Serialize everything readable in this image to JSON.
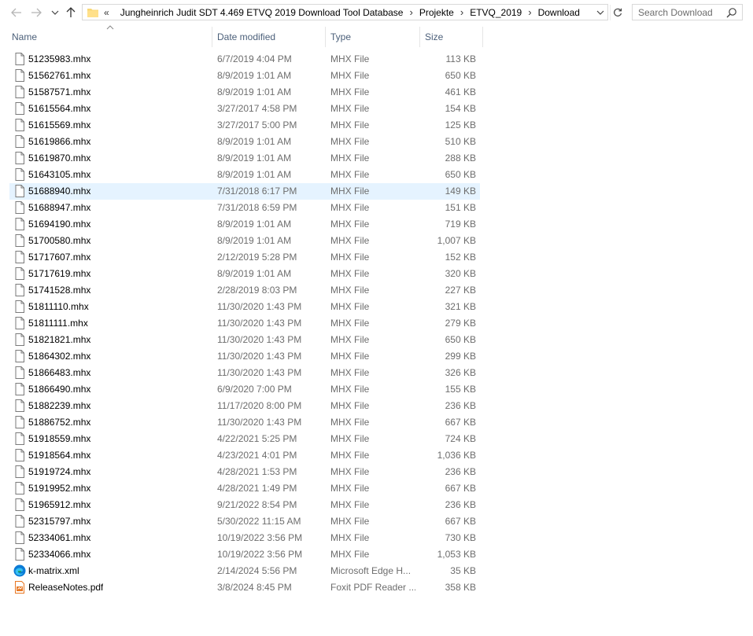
{
  "address": {
    "overflow": "«",
    "crumbs": [
      "Jungheinrich Judit SDT 4.469 ETVQ 2019 Download Tool Database",
      "Projekte",
      "ETVQ_2019",
      "Download"
    ]
  },
  "search": {
    "placeholder": "Search Download"
  },
  "columns": {
    "name": "Name",
    "date": "Date modified",
    "type": "Type",
    "size": "Size"
  },
  "files": [
    {
      "name": "51235983.mhx",
      "date": "6/7/2019 4:04 PM",
      "type": "MHX File",
      "size": "113 KB",
      "icon": "file-icon"
    },
    {
      "name": "51562761.mhx",
      "date": "8/9/2019 1:01 AM",
      "type": "MHX File",
      "size": "650 KB",
      "icon": "file-icon"
    },
    {
      "name": "51587571.mhx",
      "date": "8/9/2019 1:01 AM",
      "type": "MHX File",
      "size": "461 KB",
      "icon": "file-icon"
    },
    {
      "name": "51615564.mhx",
      "date": "3/27/2017 4:58 PM",
      "type": "MHX File",
      "size": "154 KB",
      "icon": "file-icon"
    },
    {
      "name": "51615569.mhx",
      "date": "3/27/2017 5:00 PM",
      "type": "MHX File",
      "size": "125 KB",
      "icon": "file-icon"
    },
    {
      "name": "51619866.mhx",
      "date": "8/9/2019 1:01 AM",
      "type": "MHX File",
      "size": "510 KB",
      "icon": "file-icon"
    },
    {
      "name": "51619870.mhx",
      "date": "8/9/2019 1:01 AM",
      "type": "MHX File",
      "size": "288 KB",
      "icon": "file-icon"
    },
    {
      "name": "51643105.mhx",
      "date": "8/9/2019 1:01 AM",
      "type": "MHX File",
      "size": "650 KB",
      "icon": "file-icon"
    },
    {
      "name": "51688940.mhx",
      "date": "7/31/2018 6:17 PM",
      "type": "MHX File",
      "size": "149 KB",
      "icon": "file-icon",
      "selected": true
    },
    {
      "name": "51688947.mhx",
      "date": "7/31/2018 6:59 PM",
      "type": "MHX File",
      "size": "151 KB",
      "icon": "file-icon"
    },
    {
      "name": "51694190.mhx",
      "date": "8/9/2019 1:01 AM",
      "type": "MHX File",
      "size": "719 KB",
      "icon": "file-icon"
    },
    {
      "name": "51700580.mhx",
      "date": "8/9/2019 1:01 AM",
      "type": "MHX File",
      "size": "1,007 KB",
      "icon": "file-icon"
    },
    {
      "name": "51717607.mhx",
      "date": "2/12/2019 5:28 PM",
      "type": "MHX File",
      "size": "152 KB",
      "icon": "file-icon"
    },
    {
      "name": "51717619.mhx",
      "date": "8/9/2019 1:01 AM",
      "type": "MHX File",
      "size": "320 KB",
      "icon": "file-icon"
    },
    {
      "name": "51741528.mhx",
      "date": "2/28/2019 8:03 PM",
      "type": "MHX File",
      "size": "227 KB",
      "icon": "file-icon"
    },
    {
      "name": "51811110.mhx",
      "date": "11/30/2020 1:43 PM",
      "type": "MHX File",
      "size": "321 KB",
      "icon": "file-icon"
    },
    {
      "name": "51811111.mhx",
      "date": "11/30/2020 1:43 PM",
      "type": "MHX File",
      "size": "279 KB",
      "icon": "file-icon"
    },
    {
      "name": "51821821.mhx",
      "date": "11/30/2020 1:43 PM",
      "type": "MHX File",
      "size": "650 KB",
      "icon": "file-icon"
    },
    {
      "name": "51864302.mhx",
      "date": "11/30/2020 1:43 PM",
      "type": "MHX File",
      "size": "299 KB",
      "icon": "file-icon"
    },
    {
      "name": "51866483.mhx",
      "date": "11/30/2020 1:43 PM",
      "type": "MHX File",
      "size": "326 KB",
      "icon": "file-icon"
    },
    {
      "name": "51866490.mhx",
      "date": "6/9/2020 7:00 PM",
      "type": "MHX File",
      "size": "155 KB",
      "icon": "file-icon"
    },
    {
      "name": "51882239.mhx",
      "date": "11/17/2020 8:00 PM",
      "type": "MHX File",
      "size": "236 KB",
      "icon": "file-icon"
    },
    {
      "name": "51886752.mhx",
      "date": "11/30/2020 1:43 PM",
      "type": "MHX File",
      "size": "667 KB",
      "icon": "file-icon"
    },
    {
      "name": "51918559.mhx",
      "date": "4/22/2021 5:25 PM",
      "type": "MHX File",
      "size": "724 KB",
      "icon": "file-icon"
    },
    {
      "name": "51918564.mhx",
      "date": "4/23/2021 4:01 PM",
      "type": "MHX File",
      "size": "1,036 KB",
      "icon": "file-icon"
    },
    {
      "name": "51919724.mhx",
      "date": "4/28/2021 1:53 PM",
      "type": "MHX File",
      "size": "236 KB",
      "icon": "file-icon"
    },
    {
      "name": "51919952.mhx",
      "date": "4/28/2021 1:49 PM",
      "type": "MHX File",
      "size": "667 KB",
      "icon": "file-icon"
    },
    {
      "name": "51965912.mhx",
      "date": "9/21/2022 8:54 PM",
      "type": "MHX File",
      "size": "236 KB",
      "icon": "file-icon"
    },
    {
      "name": "52315797.mhx",
      "date": "5/30/2022 11:15 AM",
      "type": "MHX File",
      "size": "667 KB",
      "icon": "file-icon"
    },
    {
      "name": "52334061.mhx",
      "date": "10/19/2022 3:56 PM",
      "type": "MHX File",
      "size": "730 KB",
      "icon": "file-icon"
    },
    {
      "name": "52334066.mhx",
      "date": "10/19/2022 3:56 PM",
      "type": "MHX File",
      "size": "1,053 KB",
      "icon": "file-icon"
    },
    {
      "name": "k-matrix.xml",
      "date": "2/14/2024 5:56 PM",
      "type": "Microsoft Edge H...",
      "size": "35 KB",
      "icon": "edge-icon"
    },
    {
      "name": "ReleaseNotes.pdf",
      "date": "3/8/2024 8:45 PM",
      "type": "Foxit PDF Reader ...",
      "size": "358 KB",
      "icon": "pdf-icon"
    }
  ]
}
